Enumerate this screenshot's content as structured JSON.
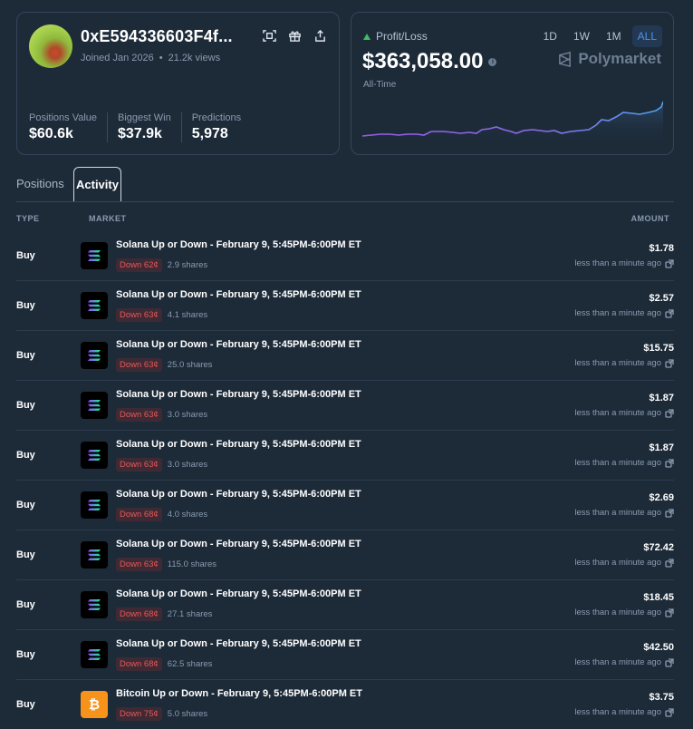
{
  "profile": {
    "address": "0xE594336603F4f...",
    "joined": "Joined Jan 2026",
    "views": "21.2k views",
    "stats": [
      {
        "label": "Positions Value",
        "value": "$60.6k"
      },
      {
        "label": "Biggest Win",
        "value": "$37.9k"
      },
      {
        "label": "Predictions",
        "value": "5,978"
      }
    ]
  },
  "pnl": {
    "label": "Profit/Loss",
    "value": "$363,058.00",
    "period_label": "All-Time",
    "brand": "Polymarket",
    "ranges": [
      "1D",
      "1W",
      "1M",
      "ALL"
    ],
    "active_range": "ALL",
    "colors": {
      "line_start": "#9b5de5",
      "line_end": "#4ea3f0",
      "positive": "#3fbf5f"
    }
  },
  "tabs": [
    "Positions",
    "Activity"
  ],
  "active_tab": "Activity",
  "table": {
    "headers": {
      "type": "TYPE",
      "market": "MARKET",
      "amount": "AMOUNT"
    },
    "rows": [
      {
        "type": "Buy",
        "icon": "solana-icon",
        "title": "Solana Up or Down - February 9, 5:45PM-6:00PM ET",
        "outcome": "Down 62¢",
        "shares": "2.9 shares",
        "amount": "$1.78",
        "time": "less than a minute ago"
      },
      {
        "type": "Buy",
        "icon": "solana-icon",
        "title": "Solana Up or Down - February 9, 5:45PM-6:00PM ET",
        "outcome": "Down 63¢",
        "shares": "4.1 shares",
        "amount": "$2.57",
        "time": "less than a minute ago"
      },
      {
        "type": "Buy",
        "icon": "solana-icon",
        "title": "Solana Up or Down - February 9, 5:45PM-6:00PM ET",
        "outcome": "Down 63¢",
        "shares": "25.0 shares",
        "amount": "$15.75",
        "time": "less than a minute ago"
      },
      {
        "type": "Buy",
        "icon": "solana-icon",
        "title": "Solana Up or Down - February 9, 5:45PM-6:00PM ET",
        "outcome": "Down 63¢",
        "shares": "3.0 shares",
        "amount": "$1.87",
        "time": "less than a minute ago"
      },
      {
        "type": "Buy",
        "icon": "solana-icon",
        "title": "Solana Up or Down - February 9, 5:45PM-6:00PM ET",
        "outcome": "Down 63¢",
        "shares": "3.0 shares",
        "amount": "$1.87",
        "time": "less than a minute ago"
      },
      {
        "type": "Buy",
        "icon": "solana-icon",
        "title": "Solana Up or Down - February 9, 5:45PM-6:00PM ET",
        "outcome": "Down 68¢",
        "shares": "4.0 shares",
        "amount": "$2.69",
        "time": "less than a minute ago"
      },
      {
        "type": "Buy",
        "icon": "solana-icon",
        "title": "Solana Up or Down - February 9, 5:45PM-6:00PM ET",
        "outcome": "Down 63¢",
        "shares": "115.0 shares",
        "amount": "$72.42",
        "time": "less than a minute ago"
      },
      {
        "type": "Buy",
        "icon": "solana-icon",
        "title": "Solana Up or Down - February 9, 5:45PM-6:00PM ET",
        "outcome": "Down 68¢",
        "shares": "27.1 shares",
        "amount": "$18.45",
        "time": "less than a minute ago"
      },
      {
        "type": "Buy",
        "icon": "solana-icon",
        "title": "Solana Up or Down - February 9, 5:45PM-6:00PM ET",
        "outcome": "Down 68¢",
        "shares": "62.5 shares",
        "amount": "$42.50",
        "time": "less than a minute ago"
      },
      {
        "type": "Buy",
        "icon": "bitcoin-icon",
        "title": "Bitcoin Up or Down - February 9, 5:45PM-6:00PM ET",
        "outcome": "Down 75¢",
        "shares": "5.0 shares",
        "amount": "$3.75",
        "time": "less than a minute ago"
      }
    ]
  }
}
